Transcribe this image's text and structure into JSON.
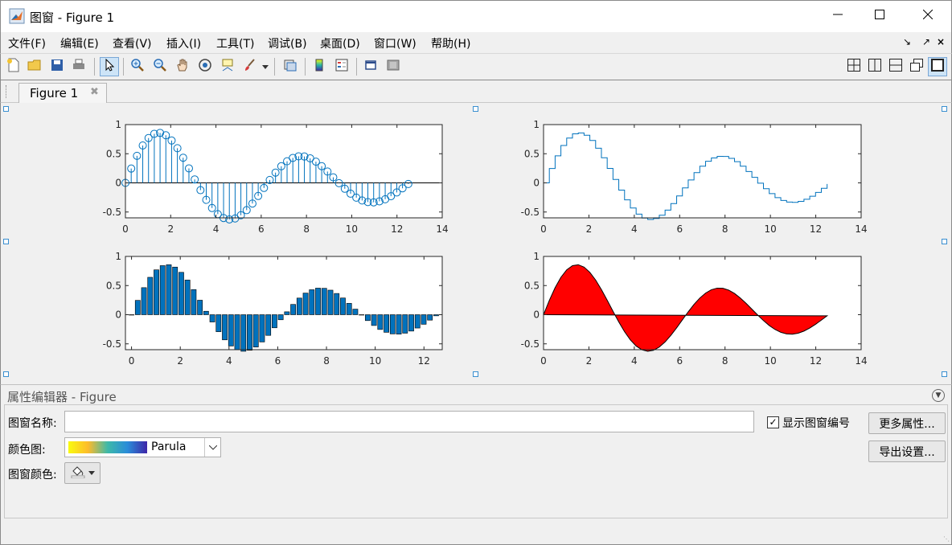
{
  "window": {
    "title": "图窗 - Figure 1",
    "controls": {
      "minimize": "minimize-icon",
      "maximize": "maximize-icon",
      "close": "close-icon"
    }
  },
  "menu": {
    "items": [
      "文件(F)",
      "编辑(E)",
      "查看(V)",
      "插入(I)",
      "工具(T)",
      "调试(B)",
      "桌面(D)",
      "窗口(W)",
      "帮助(H)"
    ],
    "pin_icons": [
      "dock-arrow-icon",
      "undock-arrow-icon"
    ]
  },
  "toolbar": {
    "left_icons": [
      "new-figure-icon",
      "open-file-icon",
      "save-icon",
      "print-icon",
      "select-arrow-icon",
      "zoom-in-icon",
      "zoom-out-icon",
      "pan-hand-icon",
      "rotate-3d-icon",
      "data-cursor-icon",
      "brush-icon",
      "link-plot-icon",
      "colorbar-icon",
      "legend-icon",
      "hide-plot-tools-icon",
      "show-plot-tools-icon"
    ],
    "right_icons": [
      "tile-2x2-icon",
      "tile-columns-icon",
      "tile-rows-icon",
      "float-icon",
      "maximize-tile-icon"
    ]
  },
  "tabs": [
    {
      "label": "Figure 1"
    }
  ],
  "axes": {
    "top_left": {
      "xticks": [
        "0",
        "2",
        "4",
        "6",
        "8",
        "10",
        "12",
        "14"
      ],
      "yticks": [
        "1",
        "0.5",
        "0",
        "-0.5"
      ]
    },
    "top_right": {
      "xticks": [
        "0",
        "2",
        "4",
        "6",
        "8",
        "10",
        "12",
        "14"
      ],
      "yticks": [
        "1",
        "0.5",
        "0",
        "-0.5"
      ]
    },
    "bottom_left": {
      "xticks": [
        "0",
        "2",
        "4",
        "6",
        "8",
        "10",
        "12"
      ],
      "yticks": [
        "1",
        "0.5",
        "0",
        "-0.5"
      ]
    },
    "bottom_right": {
      "xticks": [
        "0",
        "2",
        "4",
        "6",
        "8",
        "10",
        "12",
        "14"
      ],
      "yticks": [
        "1",
        "0.5",
        "0",
        "-0.5"
      ]
    }
  },
  "chart_data": [
    {
      "type": "stem",
      "function": "sin(x) * exp(-0.1 x)",
      "x_range": [
        0,
        12.5
      ],
      "n_points": 50,
      "xlim": [
        0,
        14
      ],
      "ylim": [
        -0.6,
        1
      ],
      "color": "#0072BD"
    },
    {
      "type": "stairs",
      "function": "sin(x) * exp(-0.1 x)",
      "x_range": [
        0,
        12.5
      ],
      "n_points": 50,
      "xlim": [
        0,
        14
      ],
      "ylim": [
        -0.6,
        1
      ],
      "color": "#0072BD"
    },
    {
      "type": "bar",
      "function": "sin(x) * exp(-0.1 x)",
      "x_range": [
        0,
        12.5
      ],
      "n_points": 50,
      "xlim": [
        -0.25,
        12.75
      ],
      "ylim": [
        -0.6,
        1
      ],
      "color": "#0072BD"
    },
    {
      "type": "fill",
      "function": "sin(x) * exp(-0.1 x)",
      "x_range": [
        0,
        12.5
      ],
      "n_points": 50,
      "xlim": [
        0,
        14
      ],
      "ylim": [
        -0.6,
        1
      ],
      "color": "#FF0000"
    }
  ],
  "property_editor": {
    "title": "属性编辑器 - Figure",
    "name_label": "图窗名称:",
    "name_value": "",
    "colormap_label": "颜色图:",
    "colormap_value": "Parula",
    "color_label": "图窗颜色:",
    "show_number_label": "显示图窗编号",
    "show_number_checked": true,
    "more_props_button": "更多属性...",
    "export_button": "导出设置..."
  }
}
